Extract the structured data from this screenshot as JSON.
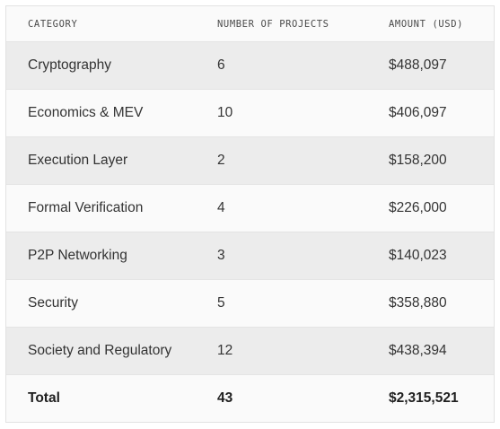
{
  "table": {
    "headers": {
      "category": "CATEGORY",
      "projects": "NUMBER OF PROJECTS",
      "amount": "AMOUNT (USD)"
    },
    "rows": [
      {
        "category": "Cryptography",
        "projects": "6",
        "amount": "$488,097"
      },
      {
        "category": "Economics & MEV",
        "projects": "10",
        "amount": "$406,097"
      },
      {
        "category": "Execution Layer",
        "projects": "2",
        "amount": "$158,200"
      },
      {
        "category": "Formal Verification",
        "projects": "4",
        "amount": "$226,000"
      },
      {
        "category": "P2P Networking",
        "projects": "3",
        "amount": "$140,023"
      },
      {
        "category": "Security",
        "projects": "5",
        "amount": "$358,880"
      },
      {
        "category": "Society and Regulatory",
        "projects": "12",
        "amount": "$438,394"
      }
    ],
    "total": {
      "category": "Total",
      "projects": "43",
      "amount": "$2,315,521"
    }
  },
  "colors": {
    "row_shaded": "#ececec",
    "row_plain": "#fafafa",
    "border": "#e2e2e2",
    "text": "#333333"
  }
}
